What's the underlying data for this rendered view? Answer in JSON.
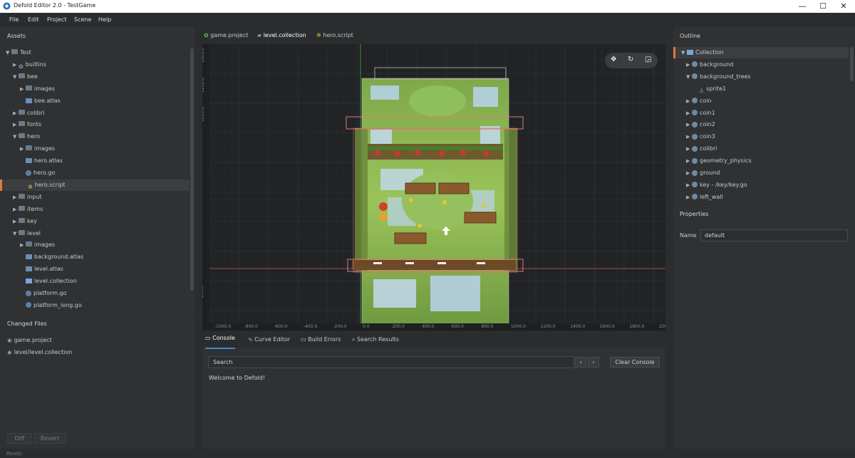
{
  "window": {
    "title": "Defold Editor 2.0 - TestGame",
    "minimize": "—",
    "maximize": "☐",
    "close": "✕"
  },
  "menu": [
    "File",
    "Edit",
    "Project",
    "Scene",
    "Help"
  ],
  "assets": {
    "header": "Assets",
    "items": [
      {
        "label": "Test",
        "depth": 0,
        "caret": "▼",
        "icon": "folder"
      },
      {
        "label": "builtins",
        "depth": 1,
        "caret": "▶",
        "icon": "builtins"
      },
      {
        "label": "bee",
        "depth": 1,
        "caret": "▼",
        "icon": "folder"
      },
      {
        "label": "images",
        "depth": 2,
        "caret": "▶",
        "icon": "folder"
      },
      {
        "label": "bee.atlas",
        "depth": 2,
        "caret": "",
        "icon": "atlas"
      },
      {
        "label": "colibri",
        "depth": 1,
        "caret": "▶",
        "icon": "folder"
      },
      {
        "label": "fonts",
        "depth": 1,
        "caret": "▶",
        "icon": "folder"
      },
      {
        "label": "hero",
        "depth": 1,
        "caret": "▼",
        "icon": "folder"
      },
      {
        "label": "images",
        "depth": 2,
        "caret": "▶",
        "icon": "folder"
      },
      {
        "label": "hero.atlas",
        "depth": 2,
        "caret": "",
        "icon": "atlas"
      },
      {
        "label": "hero.go",
        "depth": 2,
        "caret": "",
        "icon": "go"
      },
      {
        "label": "hero.script",
        "depth": 2,
        "caret": "",
        "icon": "script",
        "selected": true
      },
      {
        "label": "input",
        "depth": 1,
        "caret": "▶",
        "icon": "folder"
      },
      {
        "label": "items",
        "depth": 1,
        "caret": "▶",
        "icon": "folder"
      },
      {
        "label": "key",
        "depth": 1,
        "caret": "▶",
        "icon": "folder"
      },
      {
        "label": "level",
        "depth": 1,
        "caret": "▼",
        "icon": "folder"
      },
      {
        "label": "images",
        "depth": 2,
        "caret": "▶",
        "icon": "folder"
      },
      {
        "label": "background.atlas",
        "depth": 2,
        "caret": "",
        "icon": "atlas"
      },
      {
        "label": "level.atlas",
        "depth": 2,
        "caret": "",
        "icon": "atlas"
      },
      {
        "label": "level.collection",
        "depth": 2,
        "caret": "",
        "icon": "collection"
      },
      {
        "label": "platform.go",
        "depth": 2,
        "caret": "",
        "icon": "go"
      },
      {
        "label": "platform_long.go",
        "depth": 2,
        "caret": "",
        "icon": "go"
      }
    ]
  },
  "changed_files": {
    "header": "Changed Files",
    "items": [
      "game.project",
      "level/level.collection"
    ],
    "diff": "Diff",
    "revert": "Revert"
  },
  "tabs": [
    {
      "label": "game.project",
      "active": false,
      "closable": false
    },
    {
      "label": "level.collection",
      "active": true,
      "closable": true
    },
    {
      "label": "hero.script",
      "active": false,
      "closable": false
    }
  ],
  "ruler": {
    "x_ticks": [
      "-1000.0",
      "-800.0",
      "-600.0",
      "-400.0",
      "-200.0",
      "0.0",
      "200.0",
      "400.0",
      "600.0",
      "800.0",
      "1000.0",
      "1200.0",
      "1400.0",
      "1600.0",
      "1800.0",
      "2000."
    ],
    "y_ticks": [
      "1400.0",
      "1200.0",
      "1000.0",
      "800.0",
      "600.0",
      "400.0",
      "200.0",
      "0.0",
      "-200.0"
    ]
  },
  "console": {
    "tabs": [
      "Console",
      "Curve Editor",
      "Build Errors",
      "Search Results"
    ],
    "search_placeholder": "Search",
    "clear_label": "Clear Console",
    "message": "Welcome to Defold!"
  },
  "outline": {
    "header": "Outline",
    "items": [
      {
        "label": "Collection",
        "depth": 0,
        "caret": "▼",
        "selected": true
      },
      {
        "label": "background",
        "depth": 1,
        "caret": "▶"
      },
      {
        "label": "background_trees",
        "depth": 1,
        "caret": "▼"
      },
      {
        "label": "sprite1",
        "depth": 2,
        "caret": ""
      },
      {
        "label": "coin",
        "depth": 1,
        "caret": "▶"
      },
      {
        "label": "coin1",
        "depth": 1,
        "caret": "▶"
      },
      {
        "label": "coin2",
        "depth": 1,
        "caret": "▶"
      },
      {
        "label": "coin3",
        "depth": 1,
        "caret": "▶"
      },
      {
        "label": "colibri",
        "depth": 1,
        "caret": "▶"
      },
      {
        "label": "geometry_physics",
        "depth": 1,
        "caret": "▶"
      },
      {
        "label": "ground",
        "depth": 1,
        "caret": "▶"
      },
      {
        "label": "key - /key/key.go",
        "depth": 1,
        "caret": "▶"
      },
      {
        "label": "left_wall",
        "depth": 1,
        "caret": "▶"
      }
    ]
  },
  "properties": {
    "header": "Properties",
    "name_label": "Name",
    "name_value": "default"
  },
  "status": "Ready",
  "colors": {
    "accent": "#3d88c8",
    "selection": "#e07a3a",
    "bg": "#2a2c2e",
    "panel": "#2f3133"
  }
}
